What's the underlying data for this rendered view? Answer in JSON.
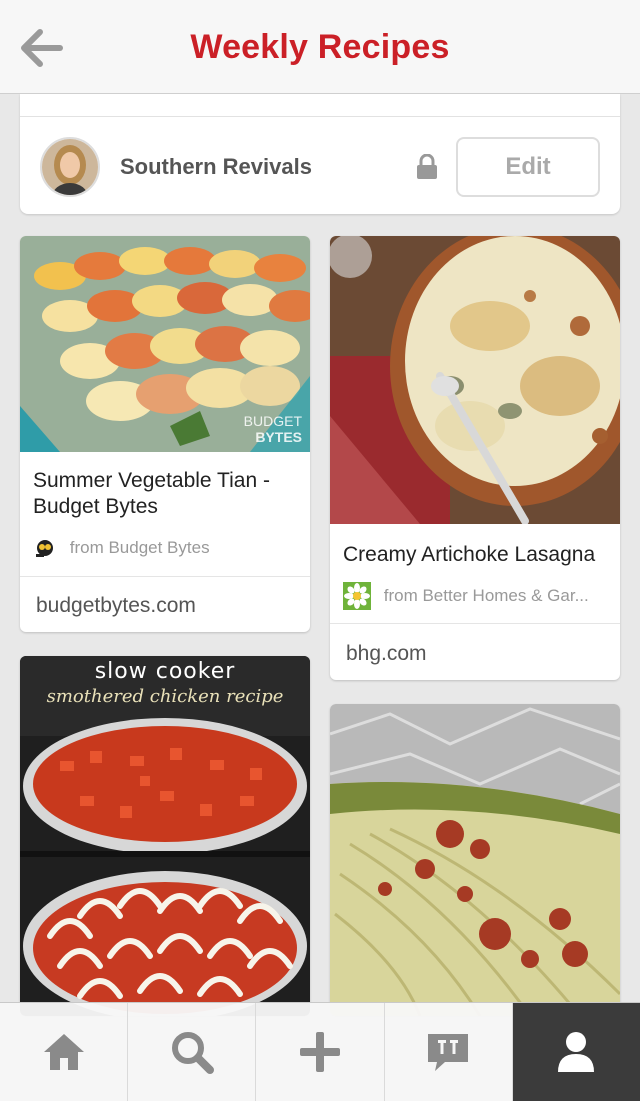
{
  "header": {
    "title": "Weekly Recipes",
    "back_icon": "back-arrow-icon"
  },
  "board": {
    "name": "Southern Revivals",
    "edit_label": "Edit",
    "private": true
  },
  "pins": [
    {
      "title": "Summer Vegetable Tian - Budget Bytes",
      "title_line1": "Summer Vegetable Tian -",
      "title_line2": "Budget Bytes",
      "source": "from Budget Bytes",
      "domain": "budgetbytes.com",
      "image_watermark_1": "BUDGET",
      "image_watermark_2": "BYTES"
    },
    {
      "title": "Creamy Artichoke Lasagna",
      "source": "from Better Homes & Gar...",
      "domain": "bhg.com"
    },
    {
      "image_caption_1": "slow cooker",
      "image_caption_2": "smothered chicken recipe"
    },
    {}
  ],
  "nav": [
    {
      "icon": "home-icon",
      "active": false
    },
    {
      "icon": "search-icon",
      "active": false
    },
    {
      "icon": "plus-icon",
      "active": false
    },
    {
      "icon": "notifications-icon",
      "active": false
    },
    {
      "icon": "profile-icon",
      "active": true
    }
  ],
  "colors": {
    "brand_red": "#cb2027",
    "nav_active": "#3b3b3b"
  }
}
